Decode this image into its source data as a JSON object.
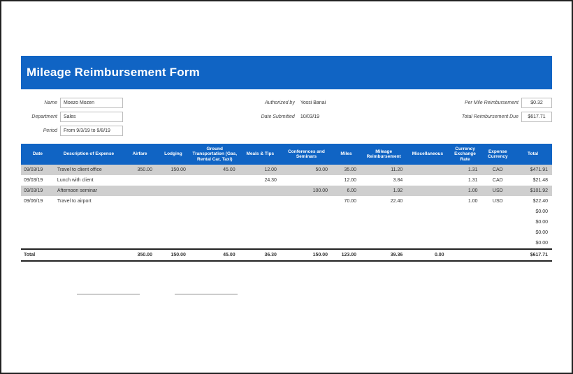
{
  "title": "Mileage Reimbursement Form",
  "labels": {
    "name": "Name",
    "department": "Department",
    "period": "Period",
    "authorized_by": "Authorized by",
    "date_submitted": "Date Submitted",
    "per_mile": "Per Mile Reimbursement",
    "total_due": "Total Reimbursement Due"
  },
  "meta": {
    "name": "Moezo Mozen",
    "department": "Sales",
    "period": "From 9/3/19 to 9/8/19",
    "authorized_by": "Yossi Banai",
    "date_submitted": "10/03/19",
    "per_mile": "$0.32",
    "total_due": "$617.71"
  },
  "headers": {
    "date": "Date",
    "desc": "Description of Expense",
    "airfare": "Airfare",
    "lodging": "Lodging",
    "ground": "Ground Transportation (Gas, Rental Car, Taxi)",
    "meals": "Meals & Tips",
    "conf": "Conferences and Seminars",
    "miles": "Miles",
    "mrem": "Mileage Reimbursement",
    "misc": "Miscellaneous",
    "fx": "Currency Exchange Rate",
    "cur": "Expense Currency",
    "total": "Total"
  },
  "rows": [
    {
      "date": "09/03/19",
      "desc": "Travel to client office",
      "airfare": "350.00",
      "lodging": "150.00",
      "ground": "45.00",
      "meals": "12.00",
      "conf": "50.00",
      "miles": "35.00",
      "mrem": "11.20",
      "misc": "",
      "fx": "1.31",
      "cur": "CAD",
      "total": "$471.91"
    },
    {
      "date": "09/03/19",
      "desc": "Lunch with client",
      "airfare": "",
      "lodging": "",
      "ground": "",
      "meals": "24.30",
      "conf": "",
      "miles": "12.00",
      "mrem": "3.84",
      "misc": "",
      "fx": "1.31",
      "cur": "CAD",
      "total": "$21.48"
    },
    {
      "date": "09/03/19",
      "desc": "Afternoon seminar",
      "airfare": "",
      "lodging": "",
      "ground": "",
      "meals": "",
      "conf": "100.00",
      "miles": "6.00",
      "mrem": "1.92",
      "misc": "",
      "fx": "1.00",
      "cur": "USD",
      "total": "$101.92"
    },
    {
      "date": "09/06/19",
      "desc": "Travel to airport",
      "airfare": "",
      "lodging": "",
      "ground": "",
      "meals": "",
      "conf": "",
      "miles": "70.00",
      "mrem": "22.40",
      "misc": "",
      "fx": "1.00",
      "cur": "USD",
      "total": "$22.40"
    }
  ],
  "blank_totals": [
    "$0.00",
    "$0.00",
    "$0.00",
    "$0.00"
  ],
  "totals": {
    "label": "Total",
    "airfare": "350.00",
    "lodging": "150.00",
    "ground": "45.00",
    "meals": "36.30",
    "conf": "150.00",
    "miles": "123.00",
    "mrem": "39.36",
    "misc": "0.00",
    "grand": "$617.71"
  },
  "chart_data": {
    "type": "table",
    "title": "Mileage Reimbursement Form",
    "per_mile_rate": 0.32,
    "total_due": 617.71,
    "columns": [
      "Date",
      "Description of Expense",
      "Airfare",
      "Lodging",
      "Ground Transportation",
      "Meals & Tips",
      "Conferences and Seminars",
      "Miles",
      "Mileage Reimbursement",
      "Miscellaneous",
      "Currency Exchange Rate",
      "Expense Currency",
      "Total"
    ],
    "rows": [
      [
        "09/03/19",
        "Travel to client office",
        350.0,
        150.0,
        45.0,
        12.0,
        50.0,
        35.0,
        11.2,
        null,
        1.31,
        "CAD",
        471.91
      ],
      [
        "09/03/19",
        "Lunch with client",
        null,
        null,
        null,
        24.3,
        null,
        12.0,
        3.84,
        null,
        1.31,
        "CAD",
        21.48
      ],
      [
        "09/03/19",
        "Afternoon seminar",
        null,
        null,
        null,
        null,
        100.0,
        6.0,
        1.92,
        null,
        1.0,
        "USD",
        101.92
      ],
      [
        "09/06/19",
        "Travel to airport",
        null,
        null,
        null,
        null,
        null,
        70.0,
        22.4,
        null,
        1.0,
        "USD",
        22.4
      ]
    ],
    "totals": {
      "airfare": 350.0,
      "lodging": 150.0,
      "ground": 45.0,
      "meals": 36.3,
      "conf": 150.0,
      "miles": 123.0,
      "mrem": 39.36,
      "misc": 0.0,
      "grand": 617.71
    }
  }
}
